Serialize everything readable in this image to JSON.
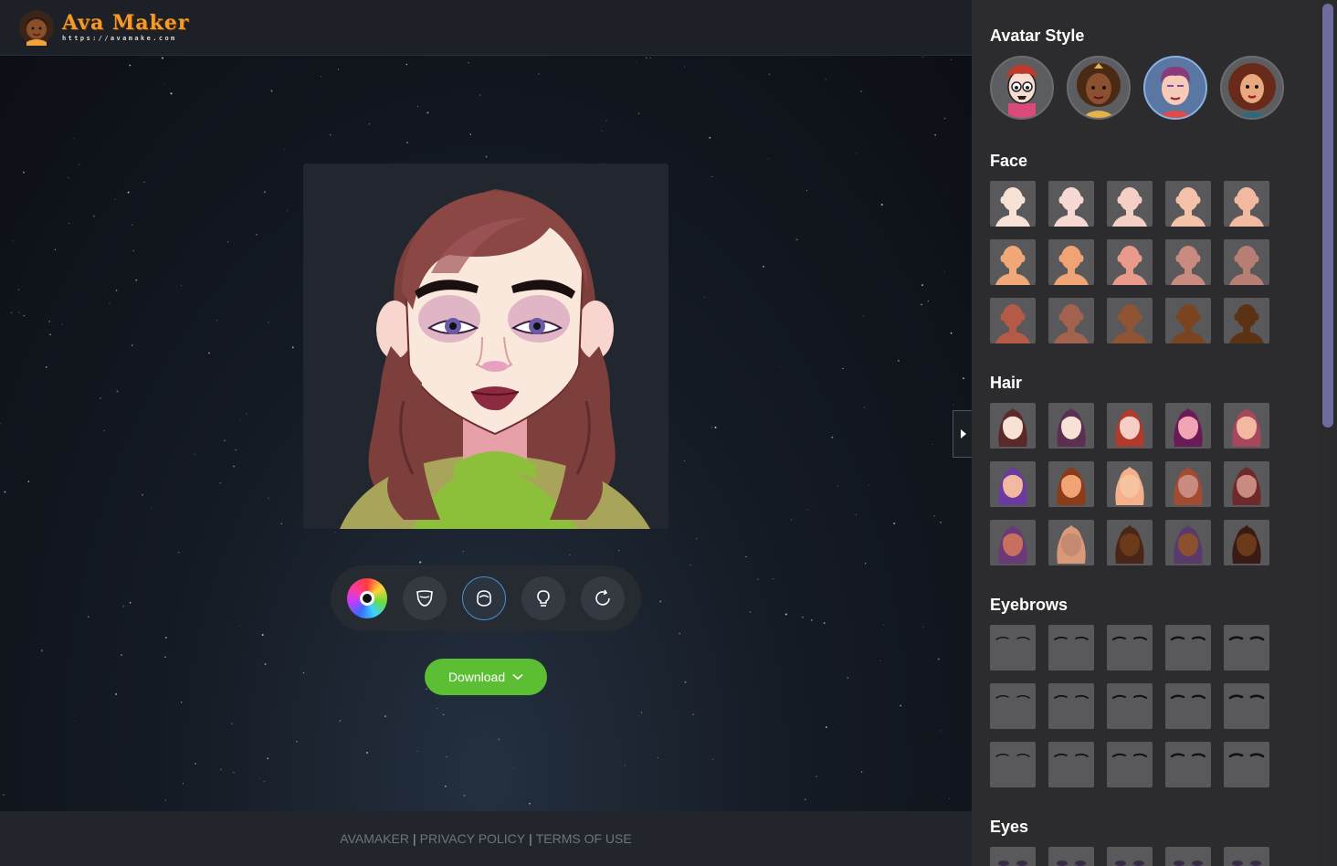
{
  "header": {
    "logo_title": "Ava Maker",
    "logo_url": "https://avamake.com"
  },
  "toolbar": {
    "tools": [
      {
        "name": "color-wheel-icon",
        "active": false
      },
      {
        "name": "mask-icon",
        "active": false
      },
      {
        "name": "face-outline-icon",
        "active": true
      },
      {
        "name": "lightbulb-icon",
        "active": false
      },
      {
        "name": "reset-icon",
        "active": false
      }
    ]
  },
  "download": {
    "label": "Download",
    "icon": "chevron-down-icon"
  },
  "footer": {
    "links": [
      "AVAMAKER",
      "PRIVACY POLICY",
      "TERMS OF USE"
    ],
    "separator": "|"
  },
  "panel": {
    "avatar_style": {
      "title": "Avatar Style",
      "selected_index": 2
    },
    "face": {
      "title": "Face",
      "skin_tones": [
        "#f8e1d5",
        "#f7d8d2",
        "#f5cfc5",
        "#f4c2a9",
        "#f3b8a0",
        "#f0a878",
        "#f0a474",
        "#ea9a8a",
        "#c98a80",
        "#b77e73",
        "#b65a48",
        "#a2624e",
        "#8e5434",
        "#7a4420",
        "#5c3214"
      ]
    },
    "hair": {
      "title": "Hair",
      "colors": [
        "#5a2a2a",
        "#5a2f4f",
        "#b03a2c",
        "#6a1a55",
        "#a6475e",
        "#6b3aa0",
        "#8b3b1a",
        "#f4b08a",
        "#a04b32",
        "#6e2a2a",
        "#6a3a78",
        "#d89a78",
        "#4a2618",
        "#5a3a6a",
        "#3a1a14"
      ],
      "skin": [
        "#f8e1d5",
        "#f8e1d5",
        "#f5cfc5",
        "#f0a4b4",
        "#f3b8a0",
        "#f3b8a0",
        "#f0a474",
        "#f7c4a2",
        "#c98a80",
        "#c98a80",
        "#c87060",
        "#c48a72",
        "#6b3a1a",
        "#8b5030",
        "#6a3a1a"
      ]
    },
    "eyebrows": {
      "title": "Eyebrows",
      "count": 15
    },
    "eyes": {
      "title": "Eyes"
    }
  },
  "colors": {
    "accent_green": "#5cbf33",
    "logo_orange": "#f39a2d",
    "panel_bg": "#2c2c2e",
    "tile_bg": "#59595b",
    "active_blue": "#4a8fd6"
  }
}
